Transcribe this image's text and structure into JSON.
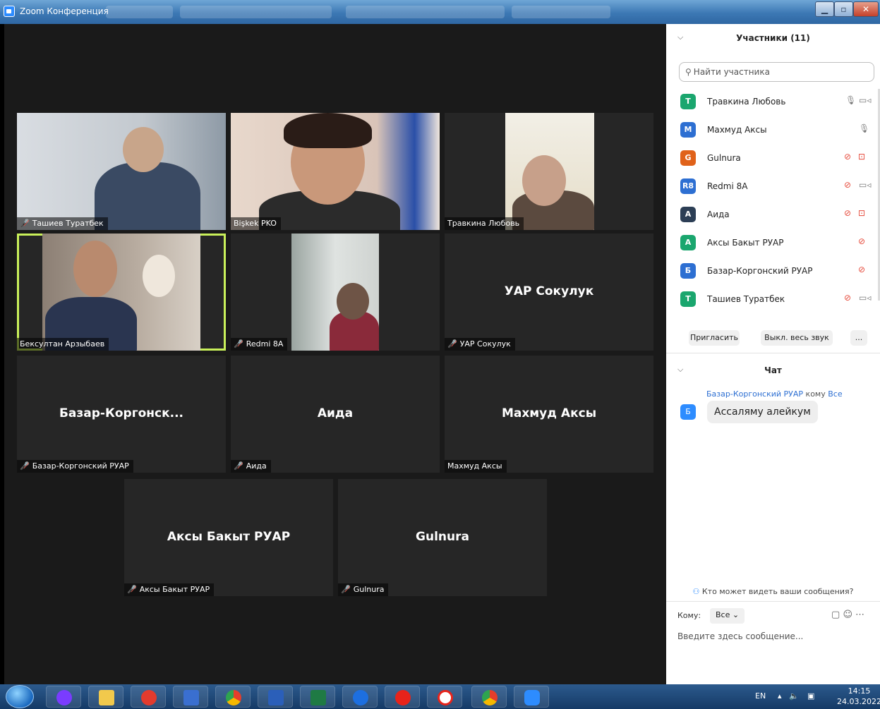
{
  "window": {
    "title": "Zoom Конференция"
  },
  "gallery": {
    "tiles": [
      {
        "label": "Ташиев Туратбек",
        "muted": true
      },
      {
        "label": "Bişkek PKO",
        "muted": false
      },
      {
        "label": "Травкина Любовь",
        "muted": false
      },
      {
        "label": "Бексултан Арзыбаев",
        "muted": false,
        "active": true
      },
      {
        "label": "Redmi 8A",
        "muted": true
      },
      {
        "label": "УАР Сокулук",
        "center": "УАР Сокулук",
        "muted": true
      },
      {
        "label": "Базар-Коргонский РУАР",
        "center": "Базар-Коргонск...",
        "muted": true
      },
      {
        "label": "Аида",
        "center": "Аида",
        "muted": true
      },
      {
        "label": "Махмуд Аксы",
        "center": "Махмуд Аксы",
        "muted": false
      },
      {
        "label": "Аксы Бакыт РУАР",
        "center": "Аксы Бакыт РУАР",
        "muted": true
      },
      {
        "label": "Gulnura",
        "center": "Gulnura",
        "muted": true
      }
    ]
  },
  "participants": {
    "title": "Участники (11)",
    "search_placeholder": "Найти участника",
    "list": [
      {
        "initials": "T",
        "name": "Травкина Любовь",
        "color": "#1aa66e",
        "mic": "on",
        "cam": "on"
      },
      {
        "initials": "M",
        "name": "Махмуд Аксы",
        "color": "#2d6fd2",
        "mic": "on",
        "cam": "none"
      },
      {
        "initials": "G",
        "name": "Gulnura",
        "color": "#e0621a",
        "mic": "off",
        "cam": "off"
      },
      {
        "initials": "R8",
        "name": "Redmi 8A",
        "color": "#2d6fd2",
        "mic": "off",
        "cam": "on"
      },
      {
        "initials": "A",
        "name": "Аида",
        "color": "#2c3e55",
        "mic": "off",
        "cam": "off"
      },
      {
        "initials": "A",
        "name": "Аксы Бакыт РУАР",
        "color": "#1aa66e",
        "mic": "off",
        "cam": "none"
      },
      {
        "initials": "Б",
        "name": "Базар-Коргонский РУАР",
        "color": "#2d6fd2",
        "mic": "off",
        "cam": "none"
      },
      {
        "initials": "T",
        "name": "Ташиев Туратбек",
        "color": "#1aa66e",
        "mic": "off",
        "cam": "on"
      }
    ],
    "invite_label": "Пригласить",
    "mute_all_label": "Выкл. весь звук",
    "more_label": "..."
  },
  "chat": {
    "title": "Чат",
    "sender": "Базар-Коргонский РУАР",
    "to_word": "кому",
    "recipient": "Все",
    "sender_initial": "Б",
    "message": "Ассаляму алейкум",
    "visibility_note": "Кто может видеть ваши сообщения?",
    "to_label": "Кому:",
    "to_value": "Все",
    "input_placeholder": "Введите здесь сообщение..."
  },
  "taskbar": {
    "lang": "EN",
    "time": "14:15",
    "date": "24.03.2022"
  },
  "colors": {
    "accent": "#2d8cff",
    "muted_red": "#e64a3b",
    "active_border": "#c9f05a"
  }
}
